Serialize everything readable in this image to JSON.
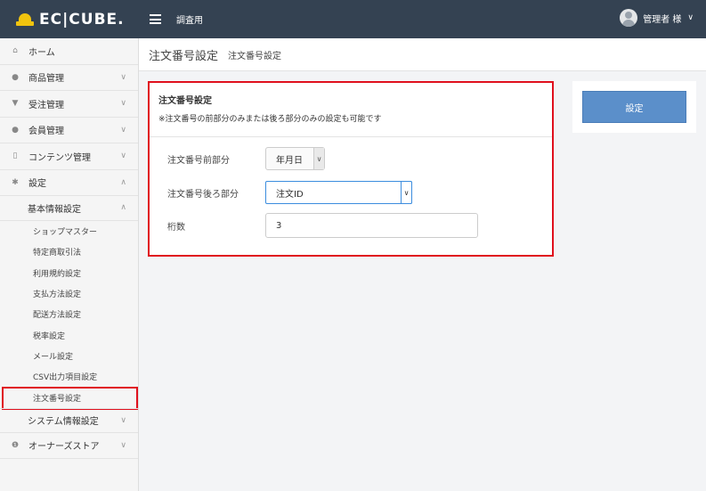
{
  "header": {
    "logo_text": "EC|CUBE.",
    "shop_name": "調査用",
    "user_name": "管理者 様"
  },
  "sidebar": {
    "items": [
      {
        "label": "ホーム",
        "icon": "home-icon"
      },
      {
        "label": "商品管理",
        "icon": "tag-icon"
      },
      {
        "label": "受注管理",
        "icon": "cart-icon"
      },
      {
        "label": "会員管理",
        "icon": "users-icon"
      },
      {
        "label": "コンテンツ管理",
        "icon": "file-icon"
      },
      {
        "label": "設定",
        "icon": "gear-icon"
      }
    ],
    "basic_settings": {
      "label": "基本情報設定",
      "children": [
        "ショップマスター",
        "特定商取引法",
        "利用規約設定",
        "支払方法設定",
        "配送方法設定",
        "税率設定",
        "メール設定",
        "CSV出力項目設定",
        "注文番号設定"
      ]
    },
    "system_settings": {
      "label": "システム情報設定"
    },
    "owners_store": {
      "label": "オーナーズストア",
      "icon": "info-circle-icon"
    }
  },
  "page": {
    "title": "注文番号設定",
    "subtitle": "注文番号設定"
  },
  "form": {
    "heading": "注文番号設定",
    "note": "※注文番号の前部分のみまたは後ろ部分のみの設定も可能です",
    "prefix_label": "注文番号前部分",
    "prefix_value": "年月日",
    "suffix_label": "注文番号後ろ部分",
    "suffix_value": "注文ID",
    "digits_label": "桁数",
    "digits_value": "3"
  },
  "actions": {
    "submit_label": "設定"
  },
  "colors": {
    "header_bg": "#344252",
    "highlight": "#e0101d",
    "primary_button": "#5b8fca",
    "logo_yellow": "#f1c40f"
  }
}
